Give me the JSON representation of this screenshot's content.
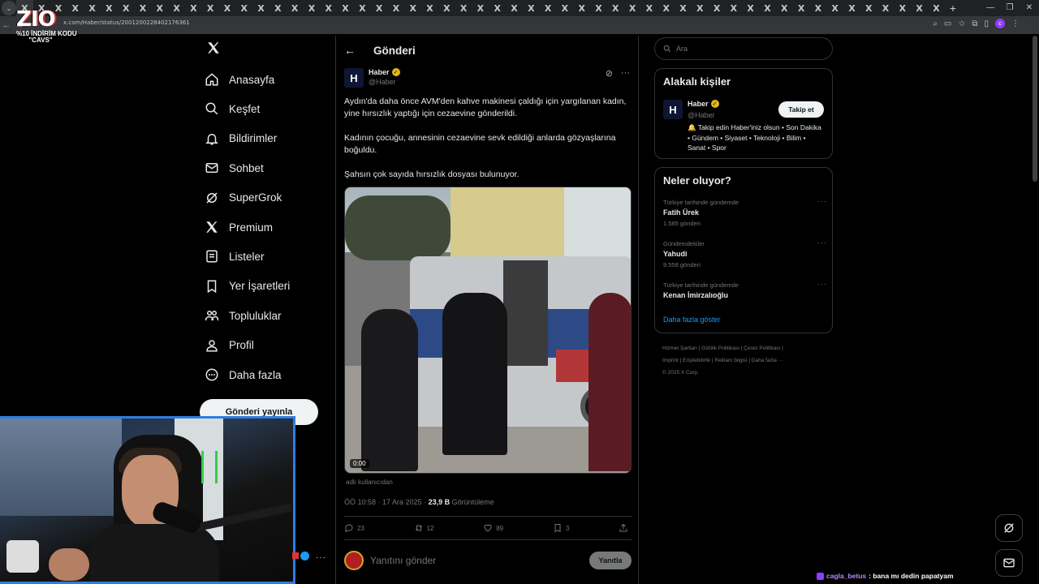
{
  "browser": {
    "url": "x.com/Haber/status/2001200228402176361",
    "tab_glyph": "X",
    "tab_count": 55,
    "new_tab": "+"
  },
  "overlay": {
    "logo_text": "ZIO",
    "promo_line": "%10 İNDİRİM KODU",
    "promo_code": "\"CAVS\""
  },
  "nav": {
    "items": [
      {
        "label": "Anasayfa",
        "icon": "home-icon"
      },
      {
        "label": "Keşfet",
        "icon": "search-icon"
      },
      {
        "label": "Bildirimler",
        "icon": "bell-icon"
      },
      {
        "label": "Sohbet",
        "icon": "mail-icon"
      },
      {
        "label": "SuperGrok",
        "icon": "grok-icon"
      },
      {
        "label": "Premium",
        "icon": "x-premium-icon"
      },
      {
        "label": "Listeler",
        "icon": "list-icon"
      },
      {
        "label": "Yer İşaretleri",
        "icon": "bookmark-icon"
      },
      {
        "label": "Topluluklar",
        "icon": "communities-icon"
      },
      {
        "label": "Profil",
        "icon": "profile-icon"
      },
      {
        "label": "Daha fazla",
        "icon": "more-circle-icon"
      }
    ],
    "post_button": "Gönderi yayınla"
  },
  "main": {
    "title": "Gönderi",
    "author": {
      "name": "Haber",
      "handle": "@Haber",
      "avatar_letter": "H"
    },
    "paragraphs": [
      "Aydın'da daha önce AVM'den kahve makinesi çaldığı için yargılanan kadın, yine hırsızlık yaptığı için cezaevine gönderildi.",
      "Kadının çocuğu, annesinin cezaevine sevk edildiği anlarda gözyaşlarına boğuldu.",
      "Şahsın çok sayıda hırsızlık dosyası bulunuyor."
    ],
    "video_time": "0:00",
    "by_user": "adlı kullanıcıdan",
    "meta_time": "ÖÖ 10:58 · 17 Ara 2025 · ",
    "views_count": "23,9 B",
    "views_label": "Görüntüleme",
    "actions": {
      "replies": "23",
      "reposts": "12",
      "likes": "89",
      "bookmarks": "3"
    },
    "reply_placeholder": "Yanıtını gönder",
    "reply_button": "Yanıtla"
  },
  "sidebar": {
    "search_placeholder": "Ara",
    "related_title": "Alakalı kişiler",
    "related": {
      "name": "Haber",
      "handle": "@Haber",
      "avatar_letter": "H",
      "follow": "Takip et",
      "bio": "🔔 Takip edin Haber'iniz olsun • Son Dakika • Gündem • Siyaset • Teknoloji • Bilim • Sanat • Spor"
    },
    "trends_title": "Neler oluyor?",
    "trends": [
      {
        "context": "Türkiye tarihinde gündemde",
        "name": "Fatih Ürek",
        "count": "1.585 gönderi"
      },
      {
        "context": "Gündemdekiler",
        "name": "Yahudi",
        "count": "9.558 gönderi"
      },
      {
        "context": "Türkiye tarihinde gündemde",
        "name": "Kenan İmirzalıoğlu",
        "count": ""
      }
    ],
    "show_more": "Daha fazla göster",
    "footer_line1": "Hizmet Şartları  |  Gizlilik Politikası  |  Çerez Politikası  |",
    "footer_line2": "Imprint  |  Erişilebilirlik  |  Reklam bilgisi  |  Daha fazla ···",
    "footer_line3": "© 2025 X Corp."
  },
  "chat": {
    "user": "cagla_betus",
    "message": ": bana mı dedin papatyam"
  },
  "colors": {
    "accent": "#1d9bf0",
    "background": "#000000",
    "border": "#2f3336",
    "verified_gold": "#e2b719"
  }
}
